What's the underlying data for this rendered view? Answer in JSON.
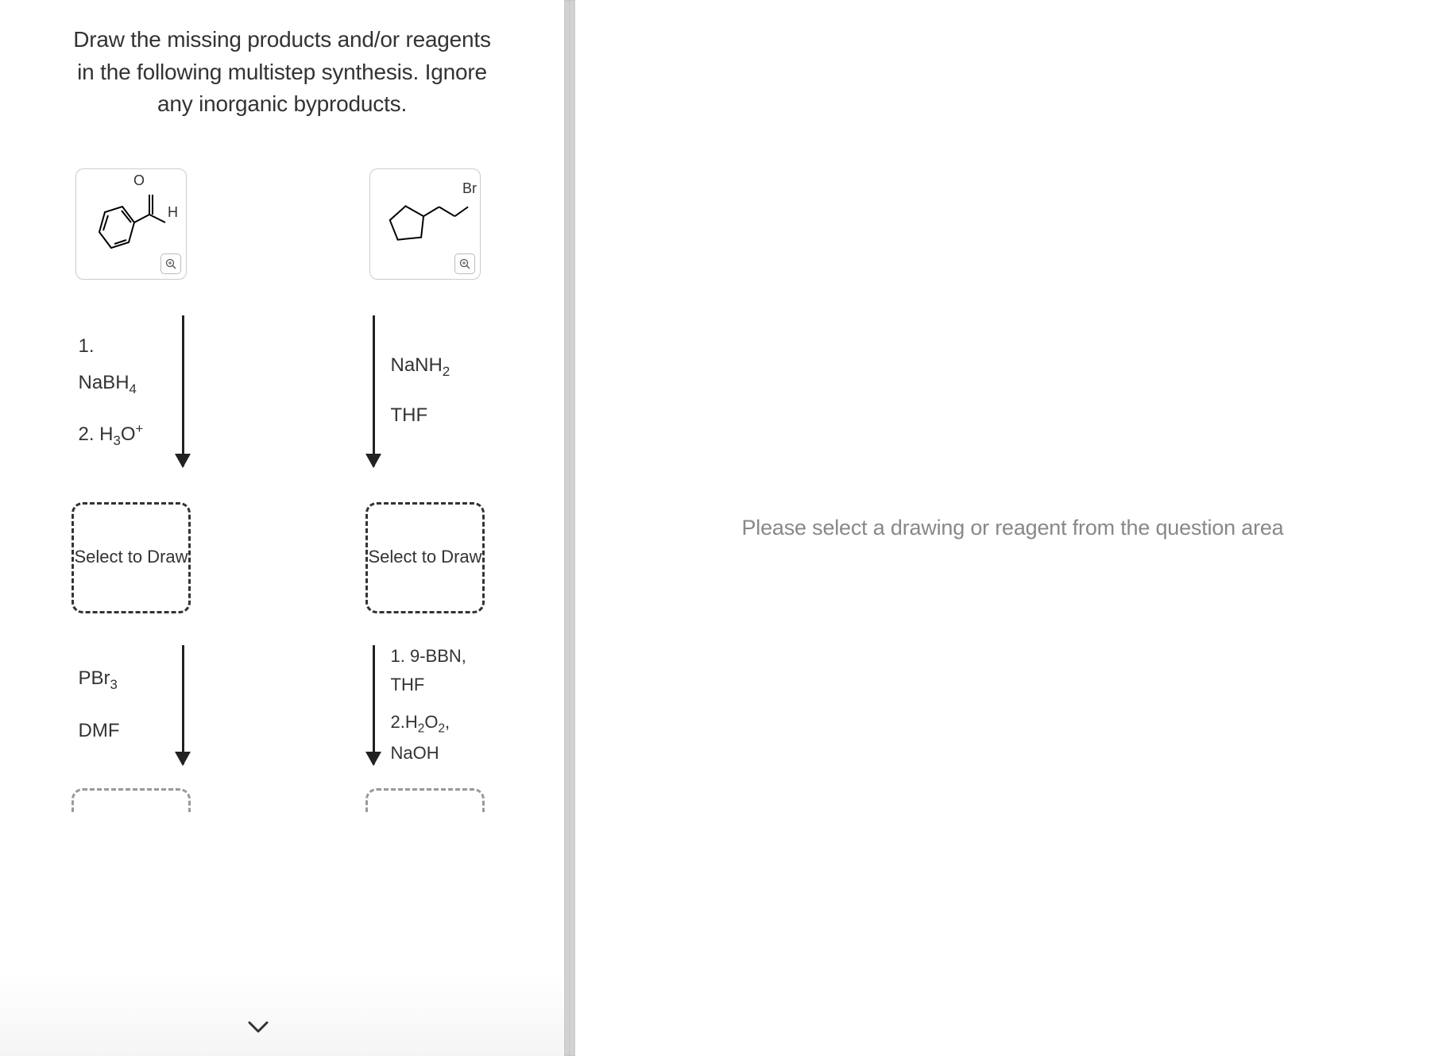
{
  "question": {
    "line1": "Draw the missing products and/or reagents",
    "line2": "in the following multistep synthesis. Ignore",
    "line3": "any inorganic byproducts."
  },
  "columns": {
    "left": {
      "molecule_labels": {
        "o": "O",
        "h": "H"
      },
      "zoom_icon": "⊕",
      "step1": {
        "reagent1": "1. NaBH₄",
        "reagent2": "2. H₃O⁺"
      },
      "draw_box": "Select to Draw",
      "step2": {
        "reagent1": "PBr₃",
        "reagent2": "DMF"
      }
    },
    "right": {
      "molecule_labels": {
        "br": "Br"
      },
      "zoom_icon": "⊕",
      "step1": {
        "reagent1": "NaNH₂",
        "reagent2": "THF"
      },
      "draw_box": "Select to Draw",
      "step2": {
        "reagent1": "1. 9-BBN, THF",
        "reagent2": "2.H₂O₂, NaOH"
      }
    }
  },
  "right_panel": {
    "placeholder": "Please select a drawing or reagent from the question area"
  },
  "chevron": "⌄"
}
